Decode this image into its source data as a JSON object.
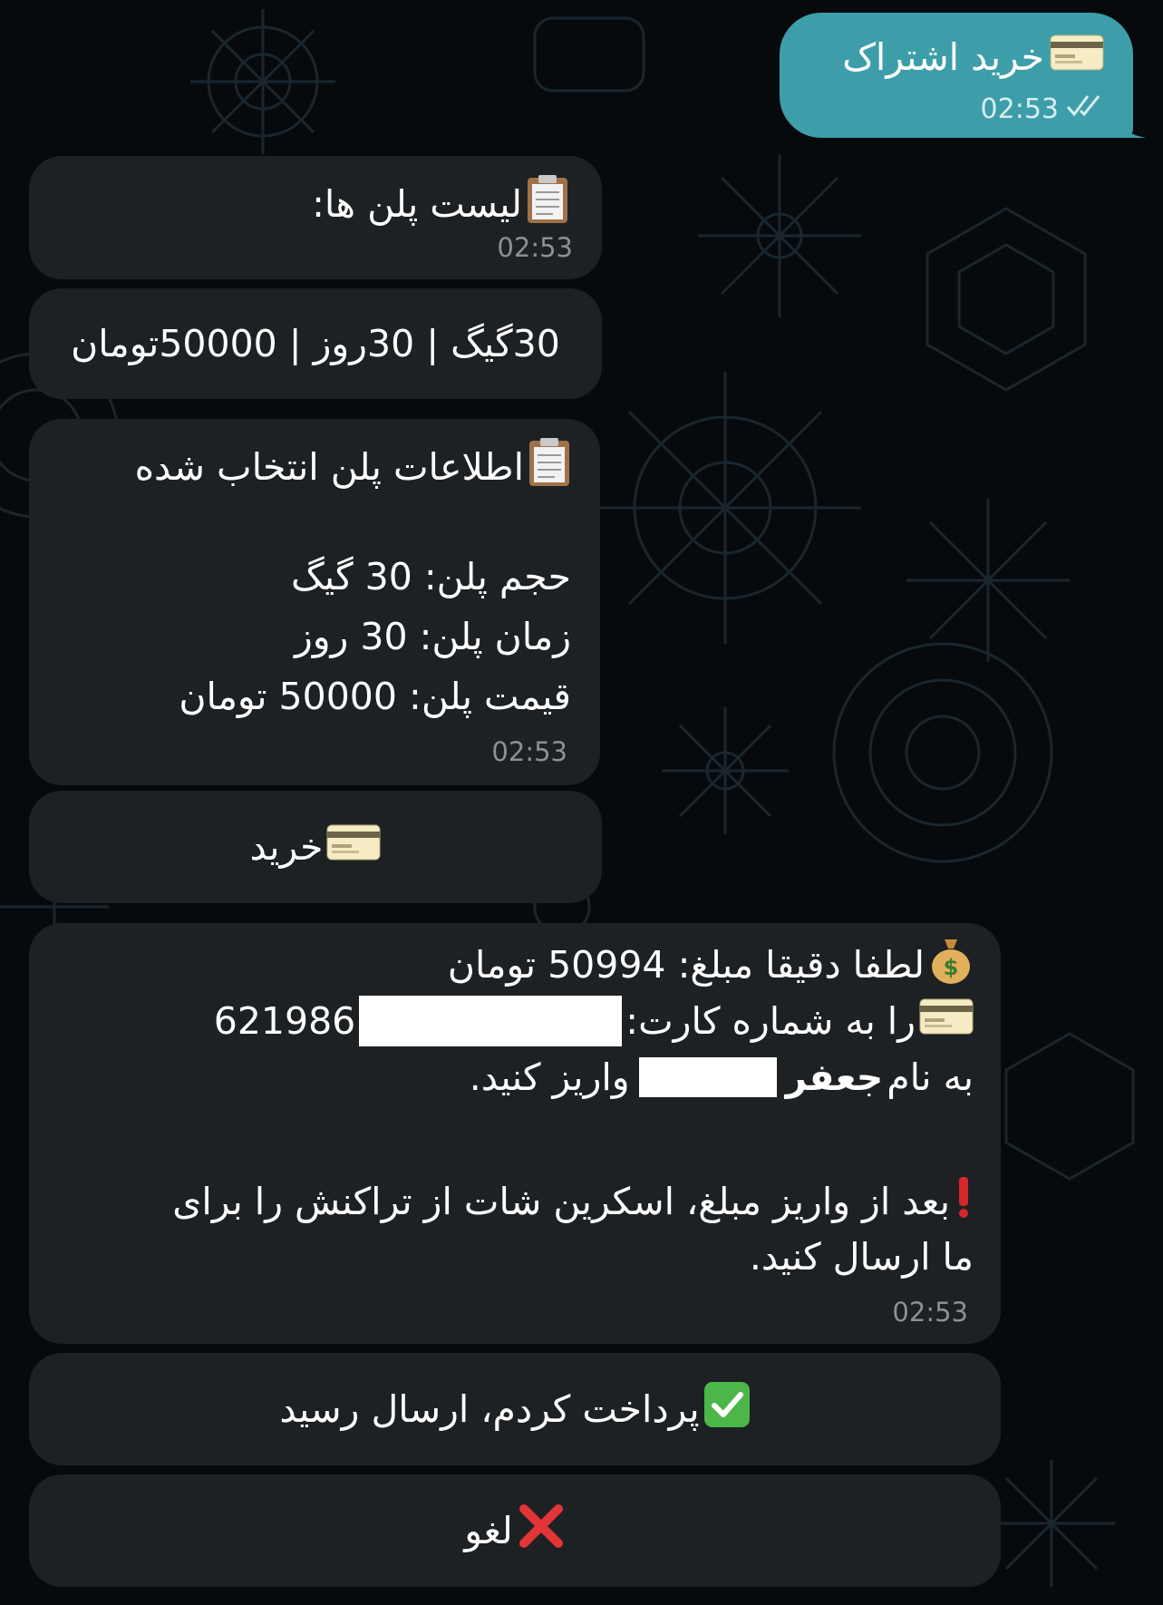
{
  "outgoing": {
    "text": "خرید اشتراک",
    "time": "02:53"
  },
  "plans_header": {
    "text": "لیست پلن ها:",
    "time": "02:53"
  },
  "plan_button": {
    "label": "30گیگ | 30روز | 50000تومان"
  },
  "plan_info": {
    "title": "اطلاعات پلن انتخاب شده",
    "volume": "حجم پلن: 30 گیگ",
    "duration": "زمان پلن: 30 روز",
    "price": "قیمت پلن: 50000 تومان",
    "time": "02:53"
  },
  "buy_button": {
    "label": "خرید"
  },
  "payment_message": {
    "line1": "لطفا دقیقا مبلغ: 50994 تومان",
    "line2_text": "را به شماره کارت: ",
    "card_prefix": "621986",
    "line3_prefix": "به نام ",
    "line3_name": "جعفر",
    "line3_suffix": "واریز کنید.",
    "notice_line1": "بعد از واریز مبلغ، اسکرین شات از تراکنش را برای",
    "notice_line2": "ما ارسال کنید.",
    "time": "02:53"
  },
  "paid_button": {
    "label": "پرداخت کردم، ارسال رسید"
  },
  "cancel_button": {
    "label": "لغو"
  },
  "colors": {
    "outgoing_bubble": "#3d9ea9",
    "incoming_bubble": "#1d2124",
    "background": "#070a0d"
  }
}
